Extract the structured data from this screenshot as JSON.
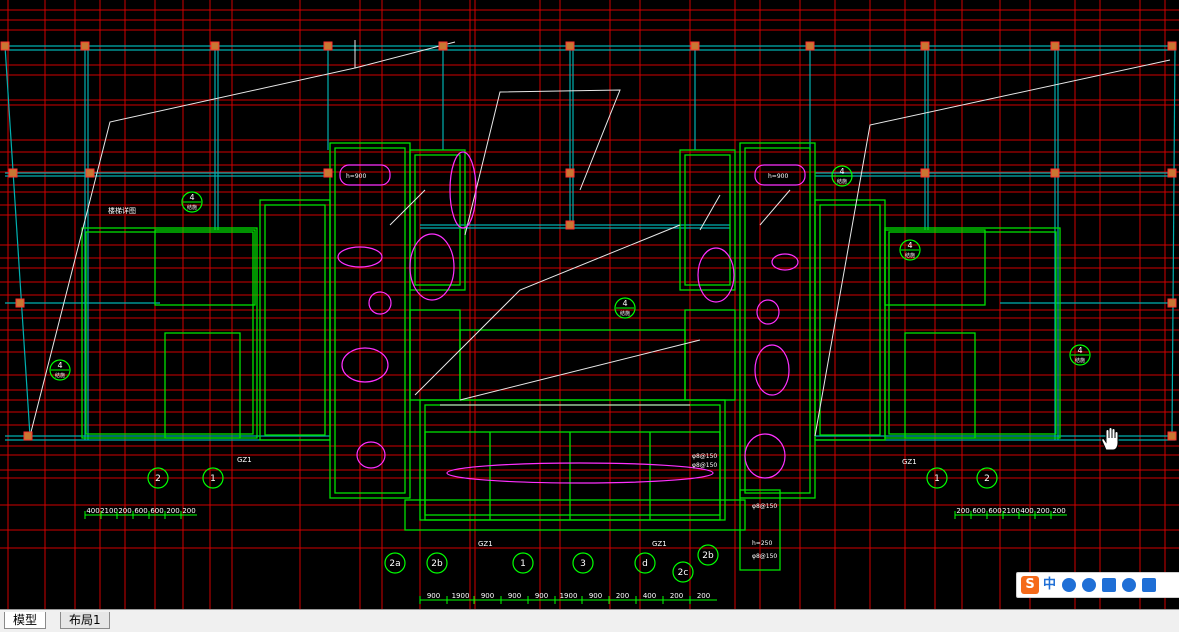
{
  "drawing": {
    "tags_green": [
      {
        "n": "4",
        "sub": "结施"
      },
      {
        "n": "4",
        "sub": "结施"
      },
      {
        "n": "4",
        "sub": "结施"
      },
      {
        "n": "4",
        "sub": "结施"
      },
      {
        "n": "4",
        "sub": "结施"
      },
      {
        "n": "4",
        "sub": "结施"
      }
    ],
    "bottom_tags": [
      "2",
      "1",
      "2a",
      "2b",
      "1",
      "3",
      "d",
      "2c",
      "2b",
      "1",
      "2"
    ],
    "gz_labels": [
      "GZ1",
      "GZ1",
      "GZ1",
      "GZ1"
    ],
    "dims_left": [
      "400",
      "2100",
      "200",
      "600",
      "600",
      "200",
      "200"
    ],
    "dims_right": [
      "200",
      "600",
      "600",
      "2100",
      "400",
      "200",
      "200"
    ],
    "dims_bottom": [
      "900",
      "1900",
      "900",
      "900",
      "900",
      "1900",
      "900",
      "200",
      "400",
      "200",
      "200"
    ],
    "notes": [
      "h=900",
      "h=900",
      "φ8@150",
      "φ8@150",
      "φ8@150",
      "h=250",
      "φ8@150"
    ],
    "left_note": "楼梯详图"
  },
  "tabs": [
    {
      "label": "模型",
      "active": true
    },
    {
      "label": "布局1",
      "active": false
    }
  ],
  "ime": {
    "logo": "S",
    "label": "中"
  },
  "colors": {
    "background": "#000000",
    "grid_red": "#ff0000",
    "axis_cyan": "#00c8c8",
    "wall_green": "#00ff00",
    "white": "#ffffff",
    "magenta": "#ff00ff",
    "column": "#c87832"
  }
}
